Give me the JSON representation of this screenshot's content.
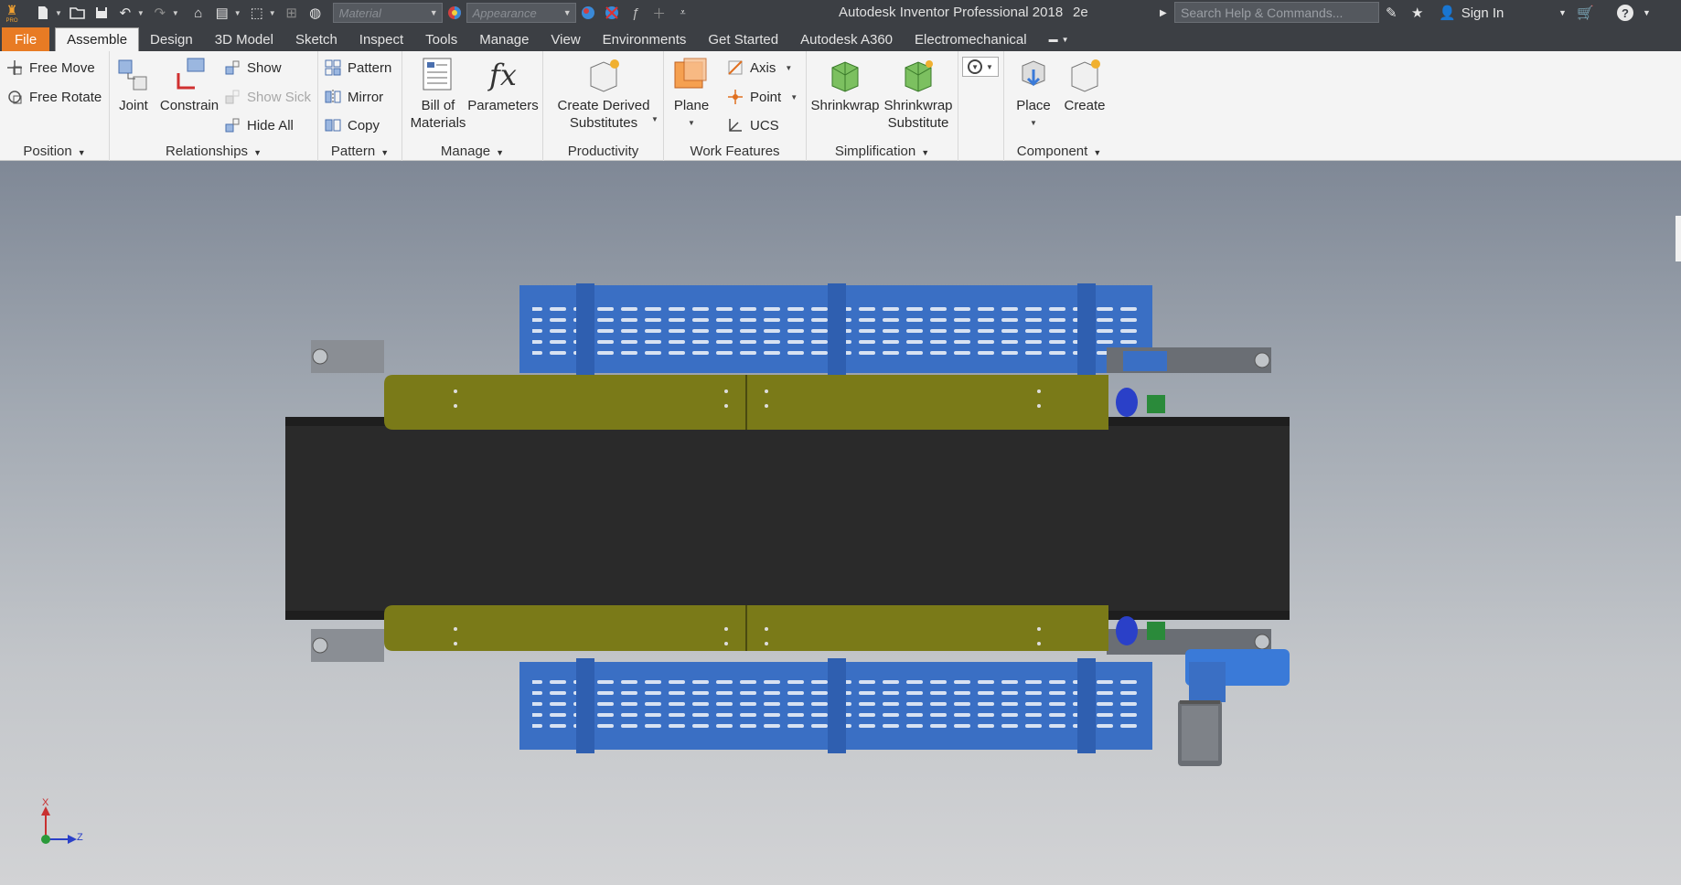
{
  "titlebar": {
    "app_title": "Autodesk Inventor Professional 2018",
    "doc_name": "2e",
    "material_placeholder": "Material",
    "appearance_placeholder": "Appearance",
    "search_placeholder": "Search Help & Commands...",
    "sign_in": "Sign In",
    "logo_small": "PRO"
  },
  "tabs": [
    {
      "label": "File"
    },
    {
      "label": "Assemble"
    },
    {
      "label": "Design"
    },
    {
      "label": "3D Model"
    },
    {
      "label": "Sketch"
    },
    {
      "label": "Inspect"
    },
    {
      "label": "Tools"
    },
    {
      "label": "Manage"
    },
    {
      "label": "View"
    },
    {
      "label": "Environments"
    },
    {
      "label": "Get Started"
    },
    {
      "label": "Autodesk A360"
    },
    {
      "label": "Electromechanical"
    }
  ],
  "ribbon": {
    "position": {
      "title": "Position",
      "free_move": "Free Move",
      "free_rotate": "Free Rotate"
    },
    "relationships": {
      "title": "Relationships",
      "joint": "Joint",
      "constrain": "Constrain",
      "show": "Show",
      "show_sick": "Show Sick",
      "hide_all": "Hide All"
    },
    "pattern": {
      "title": "Pattern",
      "pattern": "Pattern",
      "mirror": "Mirror",
      "copy": "Copy"
    },
    "manage": {
      "title": "Manage",
      "bom_line1": "Bill of",
      "bom_line2": "Materials",
      "parameters": "Parameters",
      "fx": "fx"
    },
    "productivity": {
      "title": "Productivity",
      "cds_line1": "Create Derived",
      "cds_line2": "Substitutes"
    },
    "work_features": {
      "title": "Work Features",
      "plane": "Plane",
      "axis": "Axis",
      "point": "Point",
      "ucs": "UCS"
    },
    "simplification": {
      "title": "Simplification",
      "shrinkwrap": "Shrinkwrap",
      "sws_line1": "Shrinkwrap",
      "sws_line2": "Substitute"
    },
    "component": {
      "title": "Component",
      "place": "Place",
      "create": "Create"
    }
  },
  "viewcube": {
    "x_label": "X",
    "z_label": "Z"
  },
  "colors": {
    "accent_file_tab": "#e87b24",
    "titlebar_bg": "#3c3f44",
    "conveyor_guard_blue": "#3a6fc4",
    "conveyor_belt": "#2a2a2a",
    "side_rail_olive": "#7a7a18"
  }
}
